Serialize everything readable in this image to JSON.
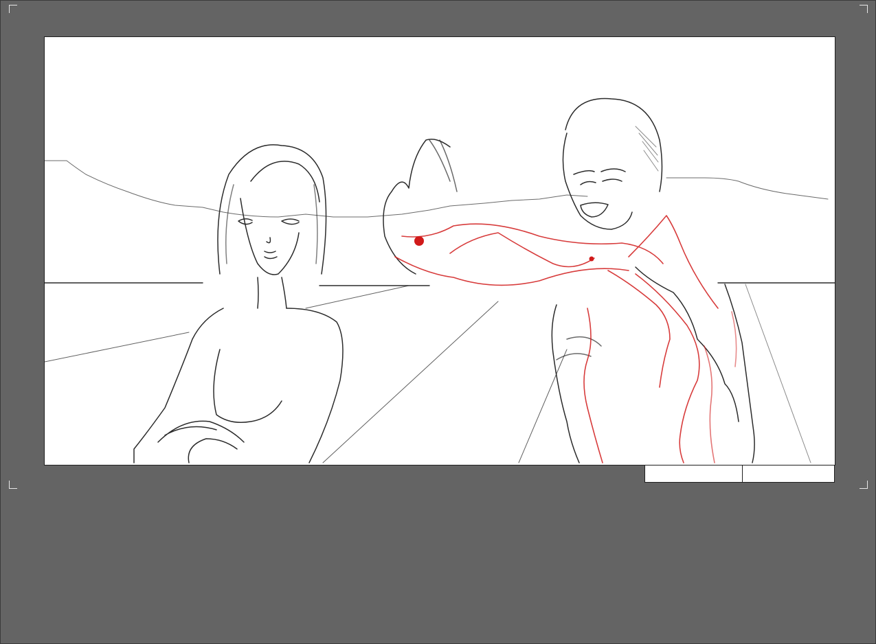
{
  "colors": {
    "background": "#646464",
    "panel": "#ffffff",
    "pencil": "#2a2a2a",
    "red_sketch": "#d11a1a"
  },
  "frame": {
    "content": "pencil-storyboard-sketch",
    "icons": [
      "crop-mark-icon"
    ]
  },
  "info_boxes": [
    {
      "value": ""
    },
    {
      "value": ""
    }
  ]
}
